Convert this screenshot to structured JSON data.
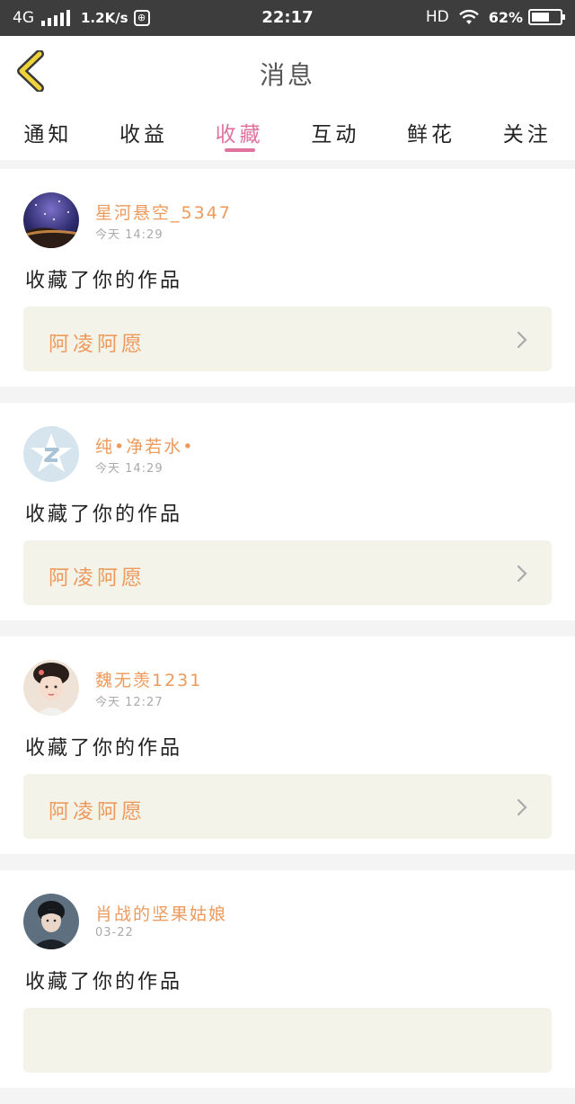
{
  "status_bar": {
    "network": "4G",
    "speed": "1.2K/s",
    "time": "22:17",
    "hd": "HD",
    "battery": "62%",
    "battery_level": 0.62
  },
  "header": {
    "title": "消息"
  },
  "tabs": [
    {
      "label": "通知",
      "active": false
    },
    {
      "label": "收益",
      "active": false
    },
    {
      "label": "收藏",
      "active": true
    },
    {
      "label": "互动",
      "active": false
    },
    {
      "label": "鲜花",
      "active": false
    },
    {
      "label": "关注",
      "active": false
    }
  ],
  "feed": [
    {
      "username": "星河悬空_5347",
      "time": "今天  14:29",
      "action": "收藏了你的作品",
      "work_title": "阿凌阿愿",
      "avatar": "galaxy-avatar"
    },
    {
      "username": "纯•净若水•",
      "time": "今天  14:29",
      "action": "收藏了你的作品",
      "work_title": "阿凌阿愿",
      "avatar": "qq-default-avatar"
    },
    {
      "username": "魏无羡1231",
      "time": "今天  12:27",
      "action": "收藏了你的作品",
      "work_title": "阿凌阿愿",
      "avatar": "costume-girl-avatar"
    },
    {
      "username": "肖战的坚果姑娘",
      "time": "03-22",
      "action": "收藏了你的作品",
      "work_title": "",
      "avatar": "dark-portrait-avatar"
    }
  ],
  "colors": {
    "accent": "#e0739e",
    "name": "#ee9a5c",
    "back_arrow": "#f0d23a",
    "work_bg": "#f3f3ea"
  },
  "icons": {
    "back": "chevron-left-icon",
    "arrow": "chevron-right-icon",
    "wifi": "wifi-icon",
    "signal": "signal-icon",
    "battery": "battery-icon"
  }
}
